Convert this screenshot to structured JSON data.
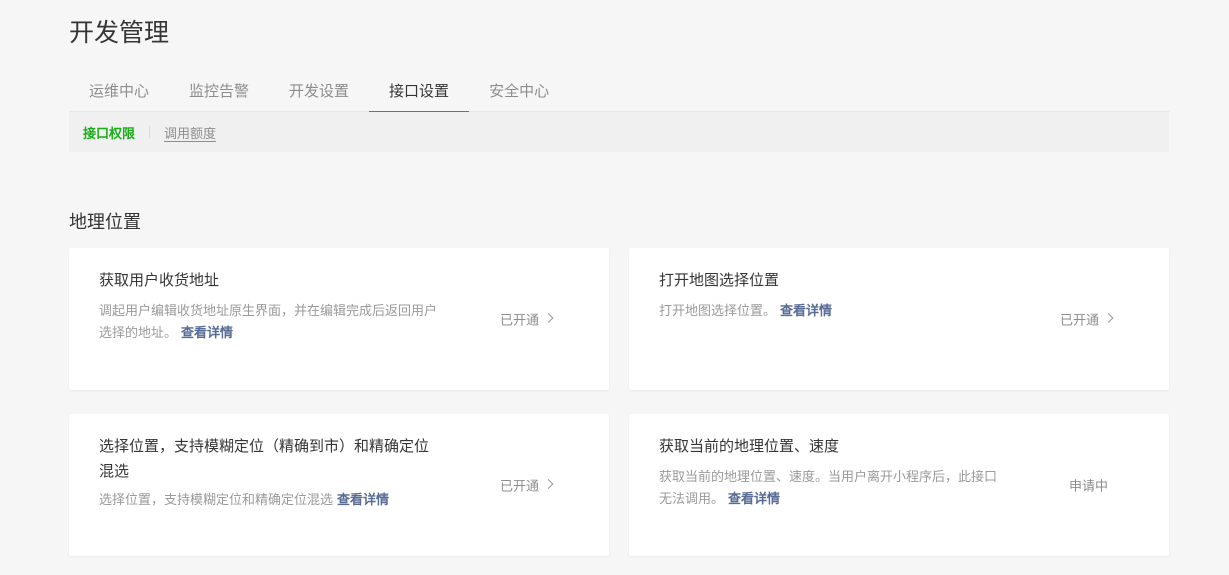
{
  "page_title": "开发管理",
  "tabs": [
    {
      "label": "运维中心"
    },
    {
      "label": "监控告警"
    },
    {
      "label": "开发设置"
    },
    {
      "label": "接口设置",
      "active": true
    },
    {
      "label": "安全中心"
    }
  ],
  "subtabs": [
    {
      "label": "接口权限",
      "active": true
    },
    {
      "label": "调用额度"
    }
  ],
  "section_title": "地理位置",
  "cards": [
    {
      "title": "获取用户收货地址",
      "desc": "调起用户编辑收货地址原生界面，并在编辑完成后返回用户选择的地址。",
      "link": "查看详情",
      "status": "已开通",
      "has_arrow": true
    },
    {
      "title": "打开地图选择位置",
      "desc": "打开地图选择位置。",
      "link": "查看详情",
      "status": "已开通",
      "has_arrow": true
    },
    {
      "title": "选择位置，支持模糊定位（精确到市）和精确定位混选",
      "desc": "选择位置，支持模糊定位和精确定位混选",
      "link": "查看详情",
      "status": "已开通",
      "has_arrow": true
    },
    {
      "title": "获取当前的地理位置、速度",
      "desc": "获取当前的地理位置、速度。当用户离开小程序后，此接口无法调用。",
      "link": "查看详情",
      "status": "申请中",
      "has_arrow": false
    }
  ],
  "colors": {
    "accent": "#1aad19",
    "link": "#576b95",
    "background": "#f6f6f6"
  }
}
